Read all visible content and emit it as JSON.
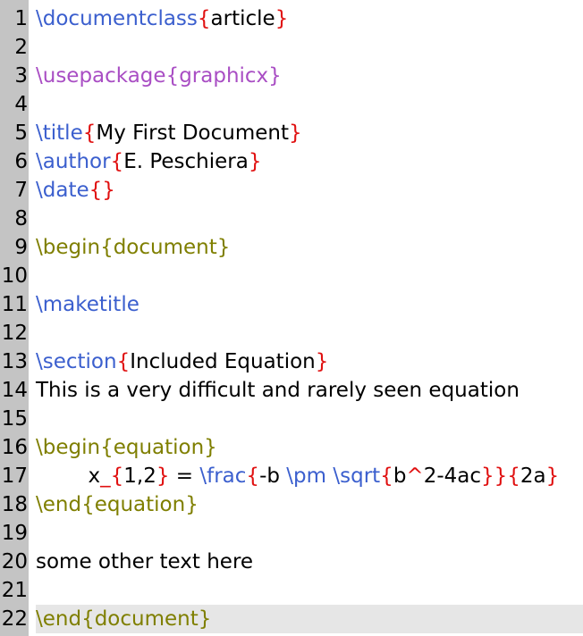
{
  "colors": {
    "command": "#3b5fce",
    "package": "#a94ec4",
    "env": "#7f7f00",
    "brace": "#e01010",
    "text": "#000000",
    "gutter": "#c4c4c4",
    "current_line": "#e6e6e6"
  },
  "editor": {
    "current_line": 22,
    "lines": [
      {
        "n": "1",
        "tokens": [
          {
            "t": "\\documentclass",
            "c": "command"
          },
          {
            "t": "{",
            "c": "brace"
          },
          {
            "t": "article",
            "c": "text"
          },
          {
            "t": "}",
            "c": "brace"
          }
        ]
      },
      {
        "n": "2",
        "tokens": []
      },
      {
        "n": "3",
        "tokens": [
          {
            "t": "\\usepackage",
            "c": "package"
          },
          {
            "t": "{graphicx}",
            "c": "package"
          }
        ]
      },
      {
        "n": "4",
        "tokens": []
      },
      {
        "n": "5",
        "tokens": [
          {
            "t": "\\title",
            "c": "command"
          },
          {
            "t": "{",
            "c": "brace"
          },
          {
            "t": "My First Document",
            "c": "text"
          },
          {
            "t": "}",
            "c": "brace"
          }
        ]
      },
      {
        "n": "6",
        "tokens": [
          {
            "t": "\\author",
            "c": "command"
          },
          {
            "t": "{",
            "c": "brace"
          },
          {
            "t": "E. Peschiera",
            "c": "text"
          },
          {
            "t": "}",
            "c": "brace"
          }
        ]
      },
      {
        "n": "7",
        "tokens": [
          {
            "t": "\\date",
            "c": "command"
          },
          {
            "t": "{}",
            "c": "brace"
          }
        ]
      },
      {
        "n": "8",
        "tokens": []
      },
      {
        "n": "9",
        "tokens": [
          {
            "t": "\\begin{document}",
            "c": "env"
          }
        ]
      },
      {
        "n": "10",
        "tokens": []
      },
      {
        "n": "11",
        "tokens": [
          {
            "t": "\\maketitle",
            "c": "command"
          }
        ]
      },
      {
        "n": "12",
        "tokens": []
      },
      {
        "n": "13",
        "tokens": [
          {
            "t": "\\section",
            "c": "command"
          },
          {
            "t": "{",
            "c": "brace"
          },
          {
            "t": "Included Equation",
            "c": "text"
          },
          {
            "t": "}",
            "c": "brace"
          }
        ]
      },
      {
        "n": "14",
        "tokens": [
          {
            "t": "This is a very difficult and rarely seen equation",
            "c": "text"
          }
        ]
      },
      {
        "n": "15",
        "tokens": []
      },
      {
        "n": "16",
        "tokens": [
          {
            "t": "\\begin{equation}",
            "c": "env"
          }
        ]
      },
      {
        "n": "17",
        "tokens": [
          {
            "t": "        x",
            "c": "text"
          },
          {
            "t": "_{",
            "c": "brace"
          },
          {
            "t": "1,2",
            "c": "text"
          },
          {
            "t": "}",
            "c": "brace"
          },
          {
            "t": " = ",
            "c": "text"
          },
          {
            "t": "\\frac",
            "c": "command"
          },
          {
            "t": "{",
            "c": "brace"
          },
          {
            "t": "-b ",
            "c": "text"
          },
          {
            "t": "\\pm",
            "c": "command"
          },
          {
            "t": " ",
            "c": "text"
          },
          {
            "t": "\\sqrt",
            "c": "command"
          },
          {
            "t": "{",
            "c": "brace"
          },
          {
            "t": "b",
            "c": "text"
          },
          {
            "t": "^",
            "c": "brace"
          },
          {
            "t": "2-4ac",
            "c": "text"
          },
          {
            "t": "}}{",
            "c": "brace"
          },
          {
            "t": "2a",
            "c": "text"
          },
          {
            "t": "}",
            "c": "brace"
          }
        ]
      },
      {
        "n": "18",
        "tokens": [
          {
            "t": "\\end{equation}",
            "c": "env"
          }
        ]
      },
      {
        "n": "19",
        "tokens": []
      },
      {
        "n": "20",
        "tokens": [
          {
            "t": "some other text here",
            "c": "text"
          }
        ]
      },
      {
        "n": "21",
        "tokens": []
      },
      {
        "n": "22",
        "tokens": [
          {
            "t": "\\end{document}",
            "c": "env"
          }
        ]
      }
    ]
  }
}
